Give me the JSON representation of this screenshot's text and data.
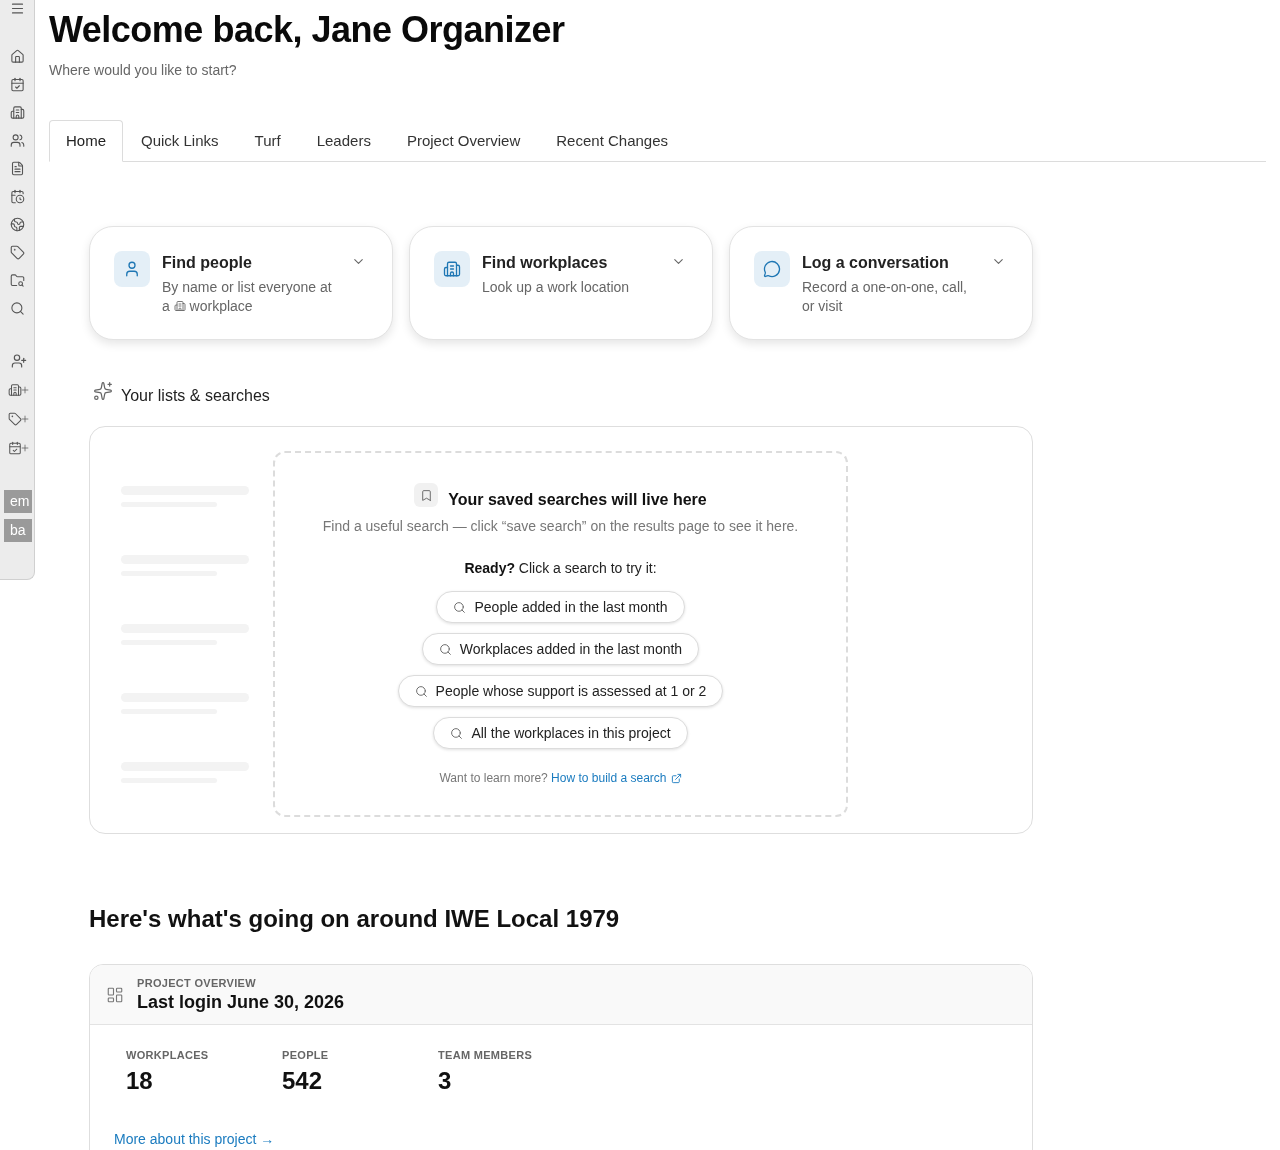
{
  "sidebar": {
    "badges": [
      "em",
      "ba"
    ]
  },
  "header": {
    "title": "Welcome back, Jane Organizer",
    "subtitle": "Where would you like to start?"
  },
  "tabs": [
    {
      "label": "Home",
      "selected": true
    },
    {
      "label": "Quick Links",
      "selected": false
    },
    {
      "label": "Turf",
      "selected": false
    },
    {
      "label": "Leaders",
      "selected": false
    },
    {
      "label": "Project Overview",
      "selected": false
    },
    {
      "label": "Recent Changes",
      "selected": false
    }
  ],
  "quick_actions": [
    {
      "title": "Find people",
      "description": [
        "By name or list everyone at a",
        "workplace"
      ]
    },
    {
      "title": "Find workplaces",
      "description": [
        "Look up a work location"
      ]
    },
    {
      "title": "Log a conversation",
      "description": [
        "Record a one-on-one, call, or visit"
      ]
    }
  ],
  "lists_section": {
    "title": "Your lists & searches",
    "empty_state": {
      "title": "Your saved searches will live here",
      "description": "Find a useful search — click “save search” on the results page to see it here.",
      "prompt": "**Ready?** Click a search to try it:",
      "suggestions": [
        "People added in the last month",
        "Workplaces added in the last month",
        "People whose support is assessed at 1 or 2",
        "All the workplaces in this project"
      ],
      "learn_more": "Want to learn more?",
      "learn_more_link": "How to build a search"
    }
  },
  "activity": {
    "title": "Here's what's going on around IWE Local 1979",
    "project_overview": {
      "eyebrow": "PROJECT OVERVIEW",
      "title": "Last login June 30, 2026",
      "stats": [
        {
          "label": "WORKPLACES",
          "value": "18"
        },
        {
          "label": "PEOPLE",
          "value": "542"
        },
        {
          "label": "TEAM MEMBERS",
          "value": "3"
        }
      ],
      "link": "More about this project →"
    }
  }
}
